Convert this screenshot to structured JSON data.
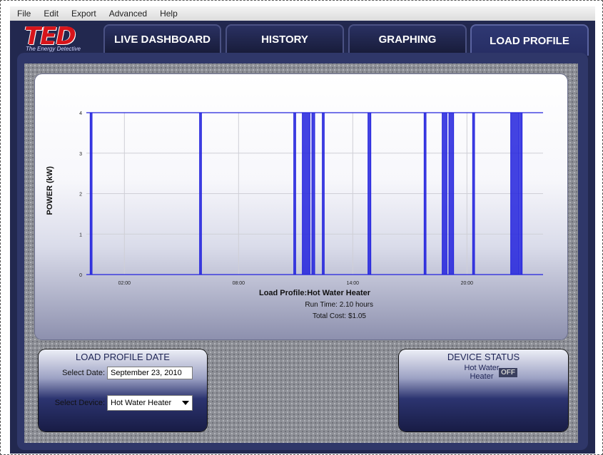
{
  "menubar": {
    "items": [
      "File",
      "Edit",
      "Export",
      "Advanced",
      "Help"
    ]
  },
  "logo": {
    "text": "TED",
    "subtitle": "The Energy Detective"
  },
  "tabs": [
    {
      "label": "LIVE DASHBOARD",
      "active": false
    },
    {
      "label": "HISTORY",
      "active": false
    },
    {
      "label": "GRAPHING",
      "active": false
    },
    {
      "label": "LOAD PROFILE",
      "active": true
    }
  ],
  "chart_data": {
    "type": "area",
    "ylabel": "POWER (kW)",
    "xlabel": "",
    "x_unit": "hours",
    "xlim": [
      0,
      24
    ],
    "ylim": [
      0,
      4
    ],
    "x_ticks": [
      "02:00",
      "08:00",
      "14:00",
      "20:00"
    ],
    "x_tick_values": [
      2,
      8,
      14,
      20
    ],
    "y_ticks": [
      "0",
      "1",
      "2",
      "3",
      "4"
    ],
    "grid": true,
    "series": [
      {
        "values_kw": 4,
        "on_intervals_hours": [
          [
            0.2,
            0.3
          ],
          [
            5.95,
            6.05
          ],
          [
            10.9,
            11.0
          ],
          [
            11.35,
            11.75
          ],
          [
            11.85,
            12.0
          ],
          [
            12.4,
            12.5
          ],
          [
            14.8,
            14.95
          ],
          [
            17.75,
            17.85
          ],
          [
            18.7,
            18.95
          ],
          [
            19.05,
            19.3
          ],
          [
            20.3,
            20.4
          ],
          [
            22.3,
            22.75
          ],
          [
            22.8,
            22.9
          ]
        ]
      }
    ],
    "color": "#2222dd",
    "title": "Load Profile:Hot Water Heater",
    "run_time": "Run Time: 2.10 hours",
    "total_cost": "Total Cost: $1.05"
  },
  "load_profile_date": {
    "title": "LOAD PROFILE DATE",
    "select_date_label": "Select Date:",
    "date_value": "September 23, 2010",
    "select_device_label": "Select Device:",
    "device_value": "Hot Water Heater"
  },
  "device_status": {
    "title": "DEVICE STATUS",
    "device_name": "Hot Water Heater",
    "state": "OFF"
  }
}
